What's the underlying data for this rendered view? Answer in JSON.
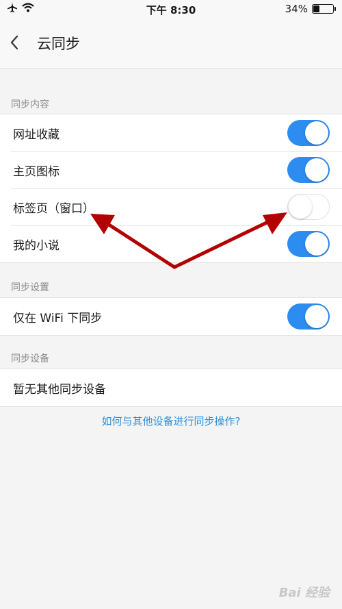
{
  "status_bar": {
    "time": "下午 8:30",
    "battery": "34%",
    "battery_level": 0.34
  },
  "nav": {
    "title": "云同步"
  },
  "sections": {
    "content": {
      "header": "同步内容",
      "items": [
        {
          "label": "网址收藏",
          "on": true
        },
        {
          "label": "主页图标",
          "on": true
        },
        {
          "label": "标签页（窗口）",
          "on": false
        },
        {
          "label": "我的小说",
          "on": true
        }
      ]
    },
    "settings": {
      "header": "同步设置",
      "items": [
        {
          "label": "仅在 WiFi 下同步",
          "on": true
        }
      ]
    },
    "devices": {
      "header": "同步设备",
      "items": [
        {
          "label": "暂无其他同步设备"
        }
      ]
    }
  },
  "help_link": "如何与其他设备进行同步操作?",
  "watermark": "Bai 经验",
  "colors": {
    "accent": "#2d8cf0",
    "arrow": "#b30000",
    "link": "#2f8ed8"
  }
}
